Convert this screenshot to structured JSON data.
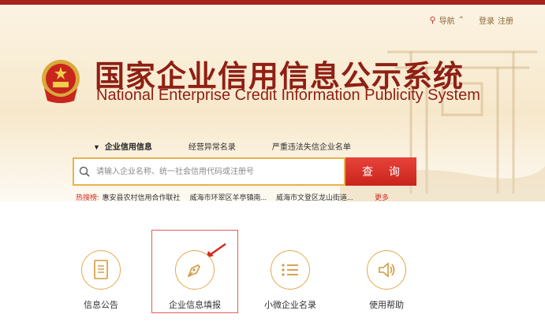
{
  "nav": {
    "guide_label": "导航",
    "login_label": "登录",
    "register_label": "注册"
  },
  "header": {
    "title_cn": "国家企业信用信息公示系统",
    "title_en": "National Enterprise Credit Information Publicity System"
  },
  "tabs": [
    {
      "label": "企业信用信息",
      "active": true
    },
    {
      "label": "经营异常名录",
      "active": false
    },
    {
      "label": "严重违法失信企业名单",
      "active": false
    }
  ],
  "search": {
    "placeholder": "请输入企业名称、统一社会信用代码或注册号",
    "button_label": "查  询"
  },
  "hot_search": {
    "label": "热搜榜:",
    "items": [
      "惠安县农村信用合作联社",
      "威海市环翠区羊亭镇南...",
      "威海市文登区龙山街道..."
    ],
    "more_label": "更多"
  },
  "services": [
    {
      "label": "信息公告",
      "icon": "document-icon"
    },
    {
      "label": "企业信息填报",
      "icon": "pen-nib-icon"
    },
    {
      "label": "小微企业名录",
      "icon": "list-icon"
    },
    {
      "label": "使用帮助",
      "icon": "speaker-icon"
    }
  ],
  "colors": {
    "brand_red": "#8f1f14",
    "accent_gold": "#e3a94e",
    "button_red": "#d9342b"
  }
}
